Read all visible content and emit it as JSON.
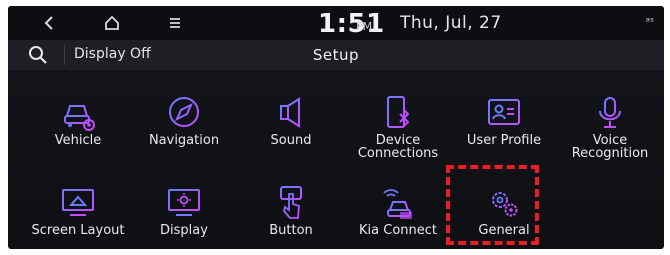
{
  "status": {
    "back_icon": "back-arrow-icon",
    "home_icon": "home-icon",
    "menu_icon": "menu-icon",
    "time": "1:51",
    "ampm": "PM",
    "date": "Thu, Jul, 27",
    "indicator": "ᵃˢ"
  },
  "header": {
    "search_icon": "search-icon",
    "display_off_label": "Display Off",
    "title": "Setup"
  },
  "tiles": [
    {
      "label": "Vehicle",
      "icon": "vehicle-gear-icon"
    },
    {
      "label": "Navigation",
      "icon": "compass-icon"
    },
    {
      "label": "Sound",
      "icon": "speaker-icon"
    },
    {
      "label": "Device\nConnections",
      "label_line1": "Device",
      "label_line2": "Connections",
      "icon": "phone-bluetooth-icon"
    },
    {
      "label": "User Profile",
      "icon": "user-card-icon"
    },
    {
      "label": "Voice\nRecognition",
      "label_line1": "Voice",
      "label_line2": "Recognition",
      "icon": "microphone-icon"
    },
    {
      "label": "Screen Layout",
      "icon": "screen-layout-icon"
    },
    {
      "label": "Display",
      "icon": "display-sun-icon"
    },
    {
      "label": "Button",
      "icon": "button-press-icon"
    },
    {
      "label": "Kia Connect",
      "icon": "car-wifi-icon"
    },
    {
      "label": "General",
      "icon": "gears-icon"
    }
  ],
  "colors": {
    "accent_purple": "#a855f7",
    "accent_blue": "#6b7cff",
    "highlight_red": "#ee1c24"
  }
}
